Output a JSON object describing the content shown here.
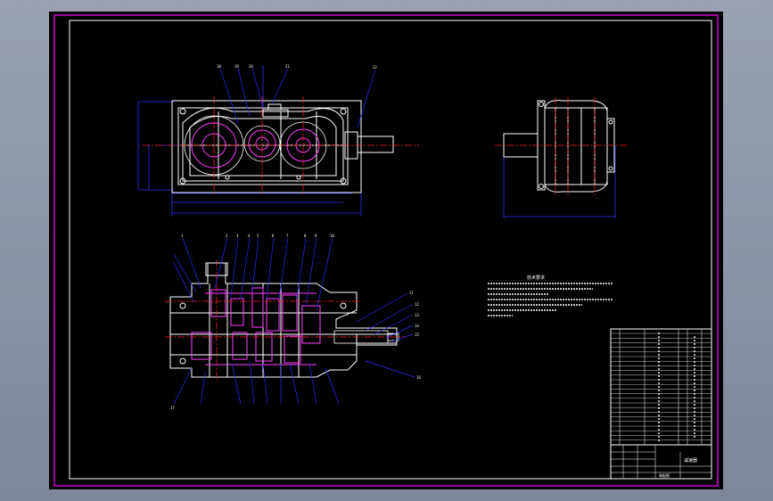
{
  "window": {
    "background_color": "#8c93a6",
    "canvas_color": "#000000"
  },
  "colors": {
    "frame": "#ff00ff",
    "geometry": "#ffffff",
    "centerline": "#ff2020",
    "dimension": "#3030ff",
    "leader": "#2a2aff",
    "gear": "#ff40ff",
    "text": "#ffffff"
  },
  "drawing": {
    "notes_title": "技术要求",
    "title_block": {
      "title": "减速器",
      "school": "装配图"
    }
  }
}
